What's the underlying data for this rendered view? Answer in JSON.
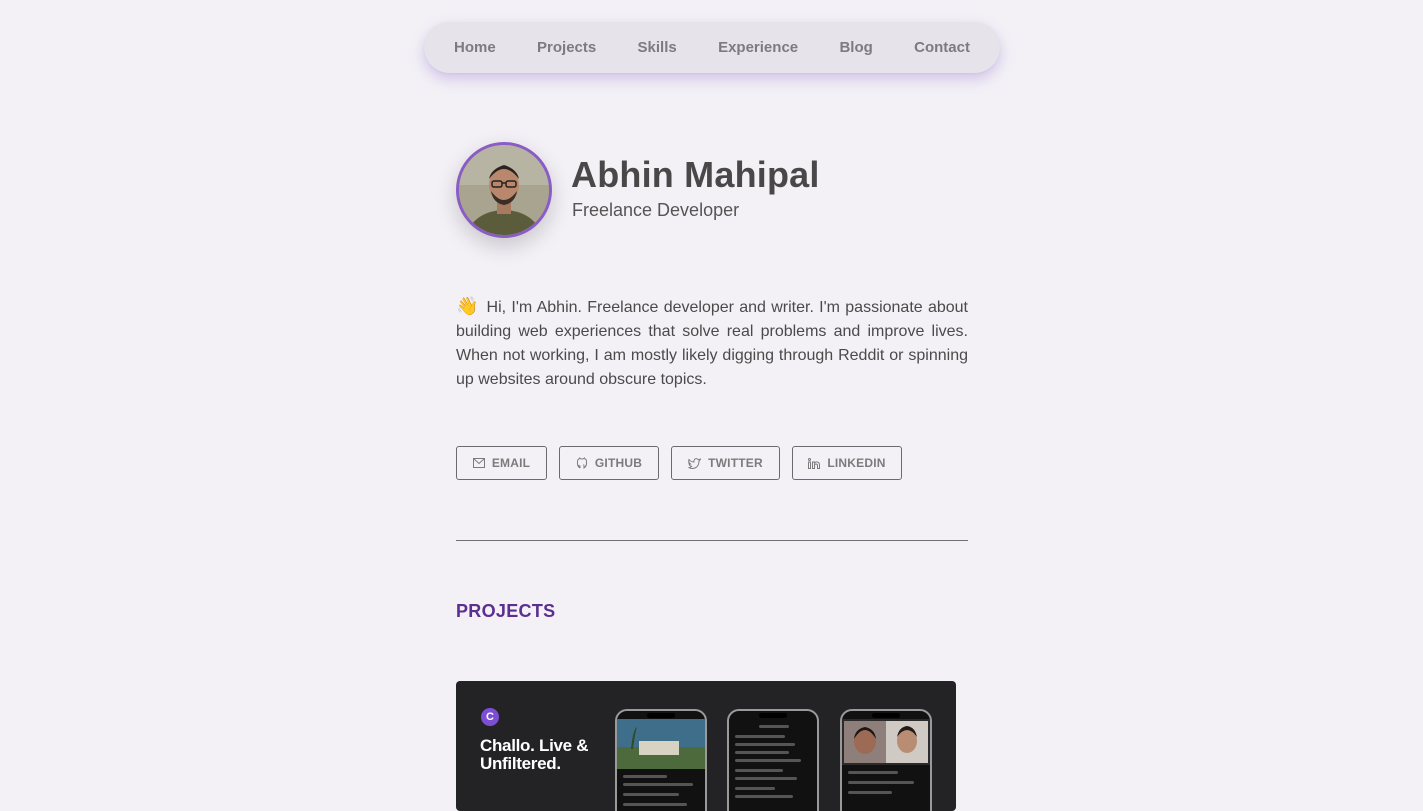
{
  "nav": {
    "links": [
      "Home",
      "Projects",
      "Skills",
      "Experience",
      "Blog",
      "Contact"
    ]
  },
  "profile": {
    "name": "Abhin Mahipal",
    "role": "Freelance Developer"
  },
  "bio": {
    "emoji": "👋",
    "text": "Hi, I'm Abhin. Freelance developer and writer. I'm passionate about building web experiences that solve real problems and improve lives. When not working, I am mostly likely digging through Reddit or spinning up websites around obscure topics."
  },
  "socials": [
    {
      "label": "EMAIL",
      "icon": "mail-icon"
    },
    {
      "label": "GITHUB",
      "icon": "github-icon"
    },
    {
      "label": "TWITTER",
      "icon": "twitter-icon"
    },
    {
      "label": "LINKEDIN",
      "icon": "linkedin-icon"
    }
  ],
  "projects": {
    "title": "PROJECTS",
    "cards": [
      {
        "logo": "C",
        "tagline": "Challo. Live & Unfiltered."
      }
    ]
  },
  "colors": {
    "background": "#f3f1f6",
    "accent": "#8a5cc6",
    "section_title": "#5b2e8f"
  }
}
